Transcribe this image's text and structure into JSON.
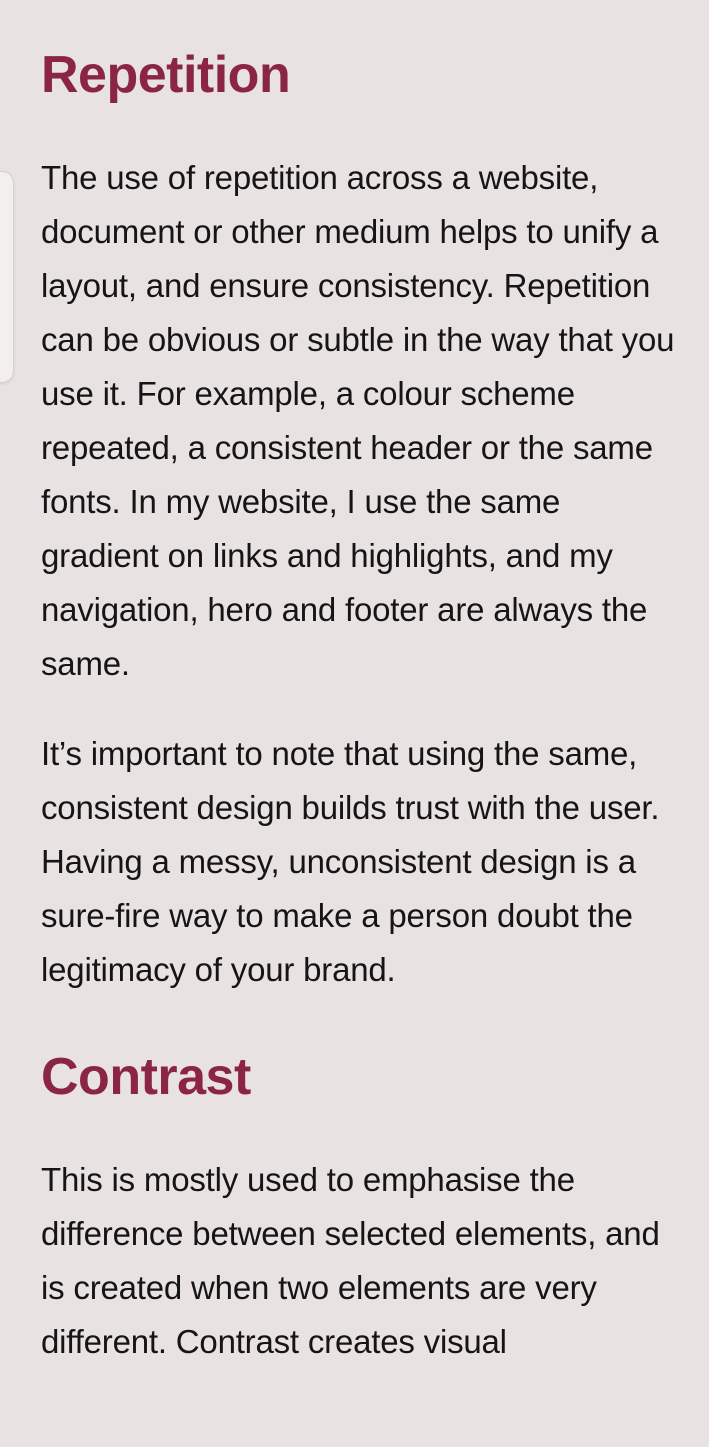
{
  "sections": [
    {
      "heading": "Repetition",
      "paragraphs": [
        "The use of repetition across a website, document or other medium helps to unify a layout, and ensure consistency. Repetition can be obvious or subtle in the way that you use it. For example, a colour scheme repeated, a consistent header or the same fonts. In my website, I use the same gradient on links and highlights, and my navigation, hero and footer are always the same.",
        "It’s important to note that using the same, consistent design builds trust with the user. Having a messy, unconsistent design is a sure-fire way to make a person doubt the legitimacy of your brand."
      ]
    },
    {
      "heading": "Contrast",
      "paragraphs": [
        "This is mostly used to emphasise the difference between selected elements, and is created when two elements are very different. Contrast creates visual"
      ]
    }
  ],
  "colors": {
    "background": "#e9e2e2",
    "heading": "#8a2644",
    "text": "#151515"
  }
}
